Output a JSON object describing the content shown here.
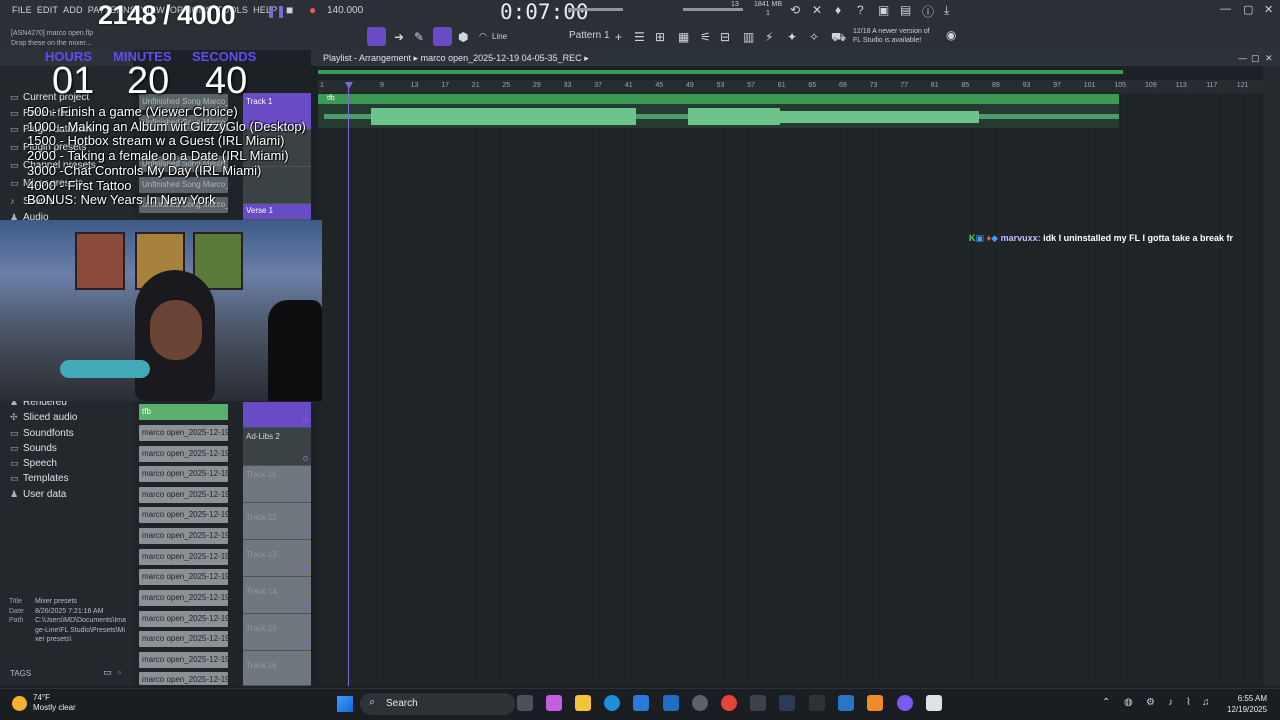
{
  "menu": [
    "FILE",
    "EDIT",
    "ADD",
    "PATTERNS",
    "VIEW",
    "OPTIONS",
    "TOOLS",
    "HELP"
  ],
  "stream_counter": "2148 / 4000",
  "transport": {
    "bpm": "140.000",
    "time": "0:07:00",
    "cpu": "13",
    "ram": "1841 MB",
    "ram2": "1"
  },
  "update_notice": {
    "line1": "12/18  A newer version of",
    "line2": "FL Studio is available!"
  },
  "pattern": "Pattern 1",
  "snap": "Line",
  "browser": {
    "hint_line1": "[ASN4270] marco open.flp",
    "hint_line2": "Drop these on the mixer...",
    "items_top": [
      "Current project",
      "Recent files",
      "Plugin database",
      "Plugin presets",
      "Channel presets",
      "Mixer presets",
      "Scores",
      "Audio"
    ],
    "items_bottom": [
      "Rendered",
      "Sliced audio",
      "Soundfonts",
      "Sounds",
      "Speech",
      "Templates",
      "User data"
    ],
    "meta": {
      "title_k": "Title",
      "title_v": "Mixer presets",
      "date_k": "Date",
      "date_v": "8/26/2025 7:21:16 AM",
      "path_k": "Path",
      "path_v": "C:\\Users\\MD\\Documents\\Image-Line\\FL Studio\\Presets\\Mixer presets\\"
    },
    "tags_label": "TAGS"
  },
  "timer": {
    "hours_label": "HOURS",
    "minutes_label": "MINUTES",
    "seconds_label": "SECONDS",
    "hours": "01",
    "minutes": "20",
    "seconds": "40"
  },
  "goals": [
    "500 - Finish a game (Viewer Choice)",
    "1000 - Making an Album wit GlizzyGlo (Desktop)",
    "1500 - Hotbox stream w a Guest (IRL Miami)",
    "2000 - Taking a female on a Date (IRL Miami)",
    "3000 -Chat Controls My Day (IRL Miami)",
    "4000 - First Tattoo",
    "BONUS: New Years In New York"
  ],
  "clips_top": [
    "Unfinished Song Marco_2..",
    "Unfinished Song Marco_2..",
    "Unfinished Song Marco_2..",
    "Unfinished Song Marco_2..",
    "Unfinished Song Marco_2.."
  ],
  "clip_tfb": "tfb",
  "clips": [
    "marco open_2025-12-19..",
    "marco open_2025-12-19..",
    "marco open_2025-12-19..",
    "marco open_2025-12-19..",
    "marco open_2025-12-19..",
    "marco open_2025-12-19..",
    "marco open_2025-12-19..",
    "marco open_2025-12-19..",
    "marco open_2025-12-19..",
    "marco open_2025-12-19..",
    "marco open_2025-12-19..",
    "marco open_2025-12-19..",
    "marco open_2025-12-19.."
  ],
  "tracks": {
    "track1": "Track 1",
    "verse1": "Verse 1",
    "adlibs": "Ad-Libs 2",
    "others": [
      "Track 11",
      "Track 12",
      "Track 13",
      "Track 14",
      "Track 15",
      "Track 16"
    ]
  },
  "playlist": {
    "title": "Playlist - Arrangement",
    "file": "marco open_2025-12-19 04-05-35_REC",
    "ruler": [
      "1",
      "9",
      "13",
      "17",
      "21",
      "25",
      "29",
      "33",
      "37",
      "41",
      "45",
      "49",
      "53",
      "57",
      "61",
      "65",
      "69",
      "73",
      "77",
      "81",
      "85",
      "89",
      "93",
      "97",
      "101",
      "105",
      "109",
      "113",
      "117",
      "121"
    ],
    "clip_label": "tfb"
  },
  "chat": {
    "user": "marvuxx:",
    "message": "idk I uninstalled my FL I gotta take a break fr"
  },
  "taskbar": {
    "temp": "74°F",
    "weather": "Mostly clear",
    "search": "Search",
    "time": "6:55 AM",
    "date": "12/19/2025"
  },
  "colors": {
    "accent_purple": "#6a4bc6",
    "clip_green": "#3b9b55",
    "wave_green": "#6ec38a"
  }
}
